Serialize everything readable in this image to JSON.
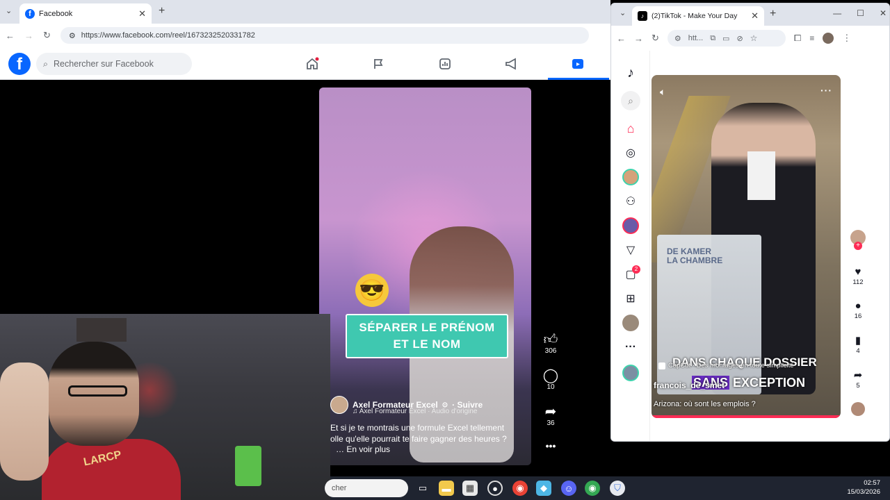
{
  "facebook_window": {
    "tab_title": "Facebook",
    "tab_close": "✕",
    "new_tab": "+",
    "url": "https://www.facebook.com/reel/1673232520331782",
    "search_placeholder": "Rechercher sur Facebook",
    "brand_color": "#0866ff",
    "logo_letter": "f"
  },
  "reel": {
    "overlay_line1": "SÉPARER LE PRÉNOM",
    "overlay_line2": "ET LE NOM",
    "author": "Axel Formateur Excel",
    "follow": "· Suivre",
    "audio": "♫ Axel Formateur Excel · Audio d'origine",
    "caption_line1": "Et si je te montrais une formule Excel tellement",
    "caption_line2": "olle qu'elle pourrait te faire gagner des heures ?",
    "see_more": "… En voir plus",
    "likes": "306",
    "comments": "10",
    "shares": "36",
    "overlay_color": "#3fc8b0"
  },
  "webcam": {
    "shirt_text": "LARCP"
  },
  "tiktok_window": {
    "tab_title": "(2)TikTok - Make Your Day",
    "tab_close": "✕",
    "new_tab": "+",
    "url": "htt...",
    "messages_badge": "2",
    "video": {
      "overlay_line1": "DANS CHAQUE DOSSIER",
      "capcut_text": "CapCut · Des montages en toute simplicité",
      "username": "francois_de_smet",
      "overlay_line2_highlight": "SANS",
      "overlay_line2_rest": " EXCEPTION",
      "description": "Arizona: où sont les emplois ?",
      "podium_text_1": "DE KAMER",
      "podium_text_2": "LA CHAMBRE"
    },
    "actions": {
      "likes": "112",
      "comments": "16",
      "saves": "4",
      "shares": "5"
    },
    "accent_color": "#fe2c55"
  },
  "taskbar": {
    "search_text": "cher",
    "time": "02:57",
    "date": "15/03/2026"
  }
}
